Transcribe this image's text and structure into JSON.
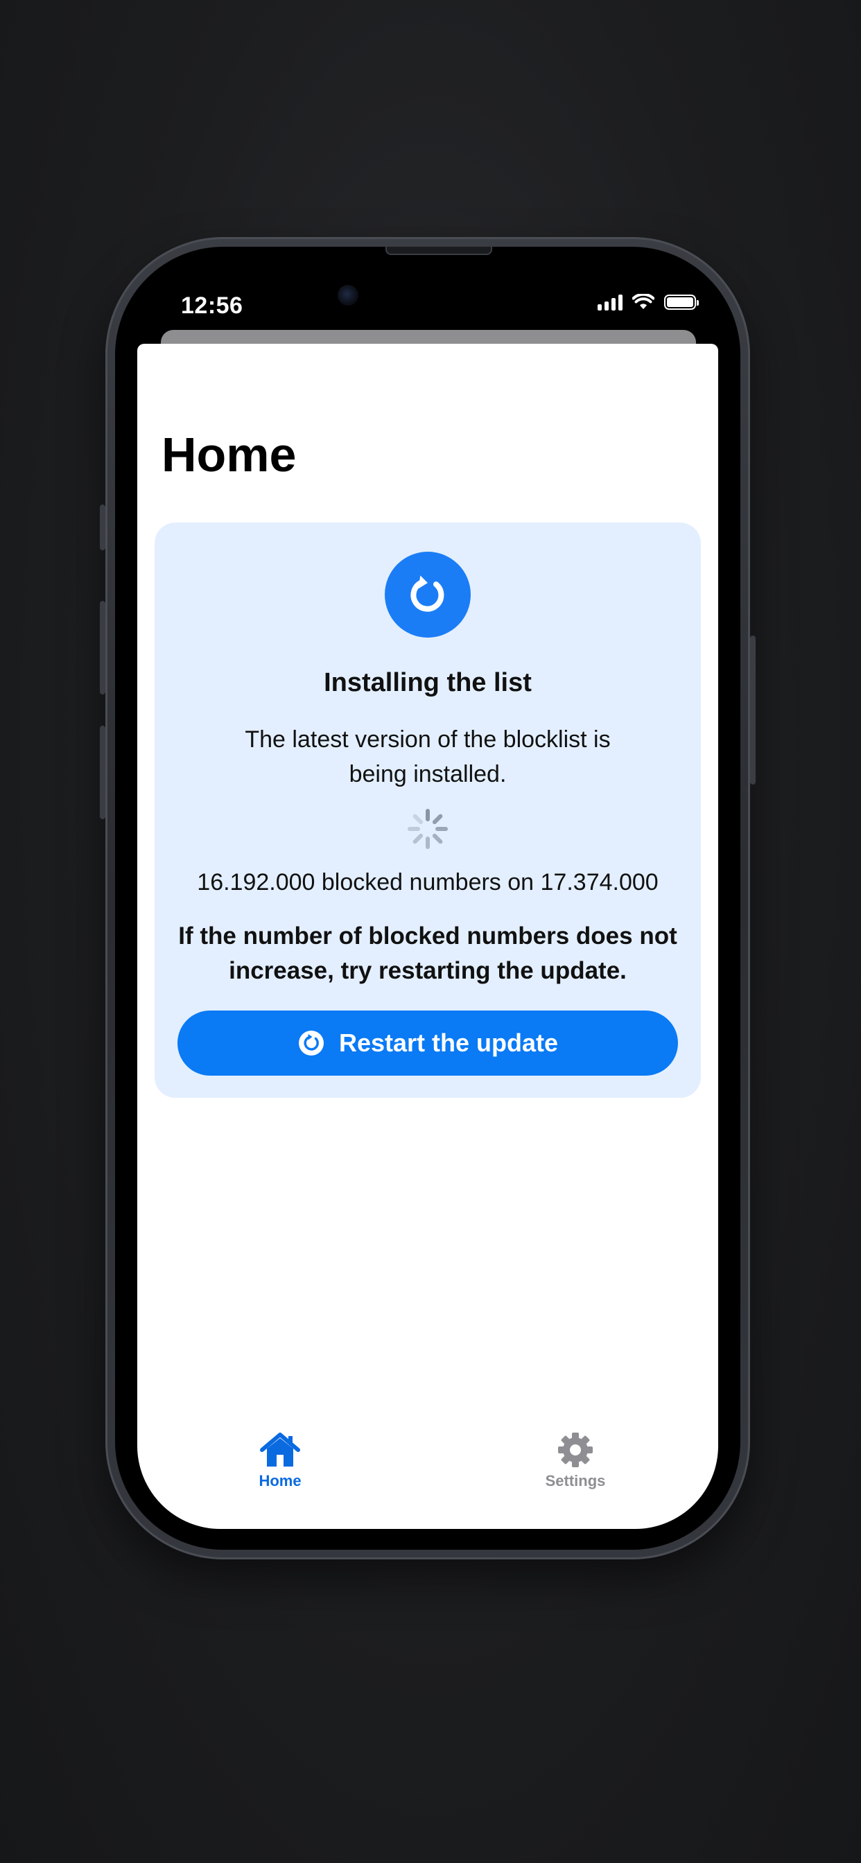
{
  "status_bar": {
    "time": "12:56",
    "icons": [
      "cellular-signal-icon",
      "wifi-icon",
      "battery-icon"
    ]
  },
  "page": {
    "title": "Home"
  },
  "install_card": {
    "icon": "refresh-icon",
    "title": "Installing the list",
    "description": "The latest version of the blocklist is being installed.",
    "progress_icon": "activity-spinner-icon",
    "count_text": "16.192.000 blocked numbers on 17.374.000",
    "hint": "If the number of blocked numbers does not increase, try restarting the update.",
    "restart_button": {
      "icon": "refresh-icon",
      "label": "Restart the update"
    }
  },
  "tabbar": {
    "items": [
      {
        "label": "Home",
        "icon": "house-icon",
        "selected": true
      },
      {
        "label": "Settings",
        "icon": "gear-icon",
        "selected": false
      }
    ]
  },
  "colors": {
    "accent": "#0a7af5",
    "card_background": "#e3efff",
    "tab_inactive": "#8e8e93"
  }
}
